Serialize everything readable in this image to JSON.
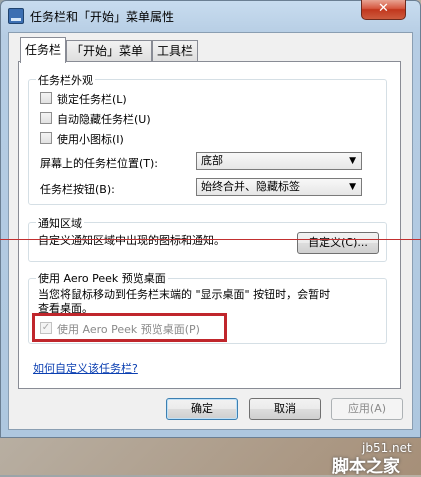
{
  "window": {
    "title": "任务栏和「开始」菜单属性",
    "close_symbol": "✕"
  },
  "tabs": [
    {
      "label": "任务栏",
      "active": true
    },
    {
      "label": "「开始」菜单",
      "active": false
    },
    {
      "label": "工具栏",
      "active": false
    }
  ],
  "appearance": {
    "legend": "任务栏外观",
    "checkboxes": [
      {
        "label": "锁定任务栏(L)",
        "checked": false
      },
      {
        "label": "自动隐藏任务栏(U)",
        "checked": false
      },
      {
        "label": "使用小图标(I)",
        "checked": false
      }
    ],
    "position_label": "屏幕上的任务栏位置(T):",
    "position_value": "底部",
    "buttons_label": "任务栏按钮(B):",
    "buttons_value": "始终合并、隐藏标签"
  },
  "notify": {
    "legend": "通知区域",
    "text": "自定义通知区域中出现的图标和通知。",
    "customize_button": "自定义(C)..."
  },
  "peek": {
    "legend": "使用 Aero Peek 预览桌面",
    "description_line1": "当您将鼠标移动到任务栏末端的 \"显示桌面\" 按钮时，会暂时",
    "description_line2": "查看桌面。",
    "checkbox_label": "使用 Aero Peek 预览桌面(P)",
    "checkbox_checked": true,
    "checkbox_enabled": false,
    "check_mark": "✓"
  },
  "help_link": "如何自定义该任务栏?",
  "footer": {
    "ok": "确定",
    "cancel": "取消",
    "apply": "应用(A)"
  },
  "watermark": {
    "site": "jb51.net",
    "name": "脚本之家"
  },
  "icons": {
    "dropdown_arrow": "▼"
  }
}
